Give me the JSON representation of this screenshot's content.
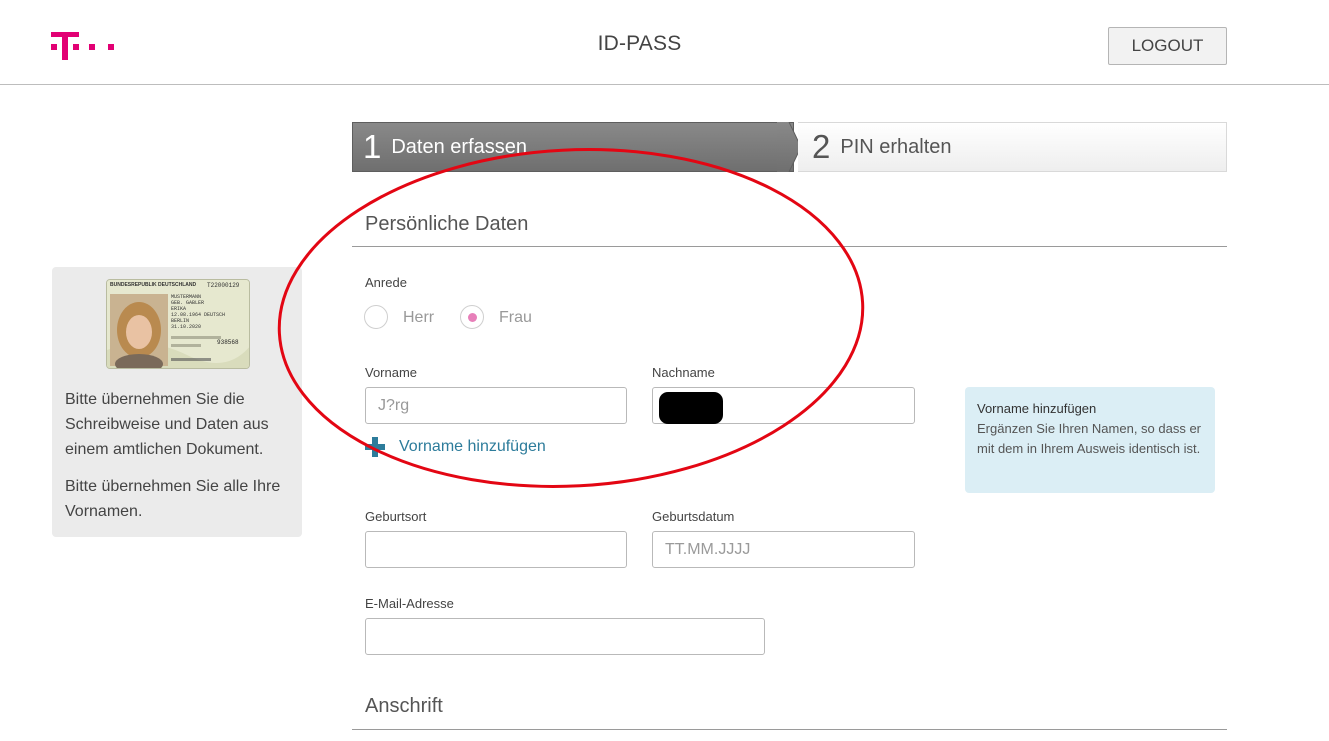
{
  "header": {
    "title": "ID-PASS",
    "logout_label": "LOGOUT",
    "brand_color": "#e20074"
  },
  "stepper": {
    "steps": [
      {
        "number": "1",
        "label": "Daten erfassen",
        "active": true
      },
      {
        "number": "2",
        "label": "PIN erhalten",
        "active": false
      }
    ]
  },
  "sidebar": {
    "paragraphs": [
      "Bitte übernehmen Sie die Schreibweise und Daten aus einem amtlichen Dokument.",
      "Bitte übernehmen Sie alle Ihre Vornamen."
    ],
    "id_card": {
      "header": "BUNDESREPUBLIK DEUTSCHLAND",
      "number": "T22000129",
      "lines": [
        "MUSTERMANN",
        "GEB. GABLER",
        "ERIKA",
        "12.08.1964 DEUTSCH",
        "BERLIN",
        "31.10.2020"
      ],
      "code": "938568"
    }
  },
  "personal": {
    "section_title": "Persönliche Daten",
    "salutation_label": "Anrede",
    "salutation_options": [
      {
        "label": "Herr",
        "checked": false
      },
      {
        "label": "Frau",
        "checked": true
      }
    ],
    "first_name_label": "Vorname",
    "first_name_value": "J?rg",
    "last_name_label": "Nachname",
    "last_name_value": "",
    "add_first_name_label": "Vorname hinzufügen",
    "birthplace_label": "Geburtsort",
    "birthplace_value": "",
    "birthdate_label": "Geburtsdatum",
    "birthdate_placeholder": "TT.MM.JJJJ",
    "email_label": "E-Mail-Adresse",
    "email_value": ""
  },
  "hint": {
    "title": "Vorname hinzufügen",
    "text": "Ergänzen Sie Ihren Namen, so dass er mit dem in Ihrem Ausweis identisch ist."
  },
  "address": {
    "section_title": "Anschrift"
  },
  "colors": {
    "radio_checked": "#e77fb9",
    "link": "#2d7c9b",
    "hint_background": "#dbeef5",
    "annotation_ellipse": "#e30613"
  }
}
